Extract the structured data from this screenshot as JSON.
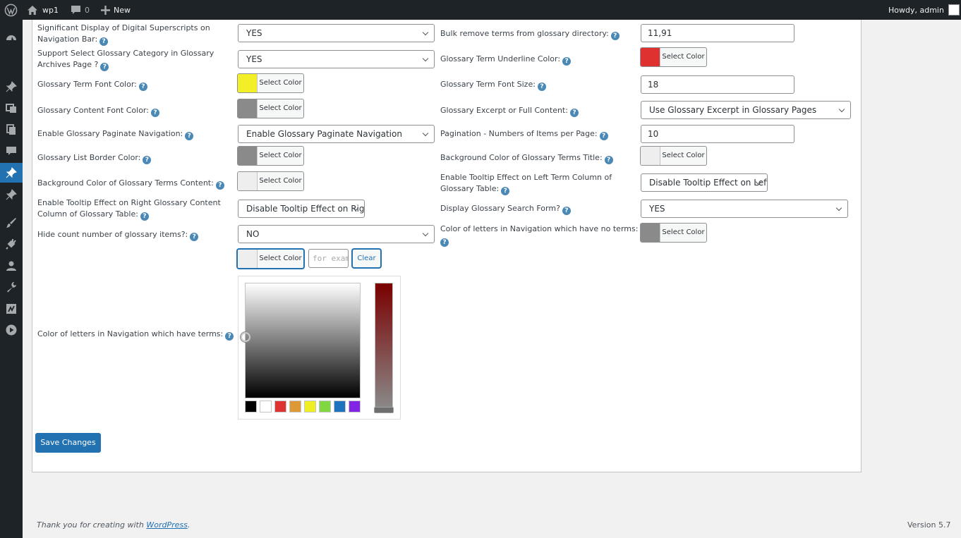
{
  "adminbar": {
    "site_name": "wp1",
    "comments_count": "0",
    "new_label": "New",
    "greeting": "Howdy, admin"
  },
  "color_button_label": "Select Color",
  "left": {
    "r1_label_a": "Significant Display of Digital Superscripts on",
    "r1_label_b": "Navigation Bar:",
    "r1_value": "YES",
    "r2_label_a": "Support Select Glossary Category in Glossary",
    "r2_label_b": "Archives Page ?",
    "r2_value": "YES",
    "r3_label": "Glossary Term Font Color:",
    "r4_label": "Glossary Content Font Color:",
    "r5_label": "Enable Glossary Paginate Navigation:",
    "r5_value": "Enable Glossary Paginate Navigation",
    "r6_label": "Glossary List Border Color:",
    "r7_label": "Background Color of Glossary Terms Content:",
    "r8_label_a": "Enable Tooltip Effect on Right Glossary Content",
    "r8_label_b": "Column of Glossary Table:",
    "r8_value": "Disable Tooltip Effect on Right",
    "r9_label": "Hide count number of glossary items?:",
    "r9_value": "NO",
    "r10_label": "Color of letters in Navigation which have terms:",
    "r10_input_placeholder": "for example",
    "r10_clear_label": "Clear"
  },
  "right": {
    "r1_label": "Bulk remove terms from glossary directory:",
    "r1_value": "11,91",
    "r2_label": "Glossary Term Underline Color:",
    "r3_label": "Glossary Term Font Size:",
    "r3_value": "18",
    "r4_label": "Glossary Excerpt or Full Content:",
    "r4_value": "Use Glossary Excerpt in Glossary Pages",
    "r5_label": "Pagination - Numbers of Items per Page:",
    "r5_value": "10",
    "r6_label": "Background Color of Glossary Terms Title:",
    "r7_label_a": "Enable Tooltip Effect on Left Term Column of",
    "r7_label_b": "Glossary Table:",
    "r7_value": "Disable Tooltip Effect on Left",
    "r8_label": "Display Glossary Search Form?",
    "r8_value": "YES",
    "r9_label": "Color of letters in Navigation which have no terms:"
  },
  "colors": {
    "term_font": "#f2ee27",
    "content_font": "#8a8a8a",
    "border": "#8a8a8a",
    "bg_content": "#eeeeee",
    "underline": "#e03131",
    "bg_title": "#eeeeee",
    "no_terms": "#8a8a8a",
    "have_terms": "#eeeeee",
    "accent": "#2271b1",
    "hue_top": "#7a0000",
    "hue_bottom": "#8a8a8a"
  },
  "palette": [
    "#000000",
    "#ffffff",
    "#dd3333",
    "#dd9933",
    "#eeee22",
    "#81d742",
    "#1e73be",
    "#8224e3"
  ],
  "save_label": "Save Changes",
  "footer": {
    "thanks_prefix": "Thank you for creating with",
    "wp_link": "WordPress",
    "thanks_suffix": ".",
    "version": "Version 5.7"
  }
}
